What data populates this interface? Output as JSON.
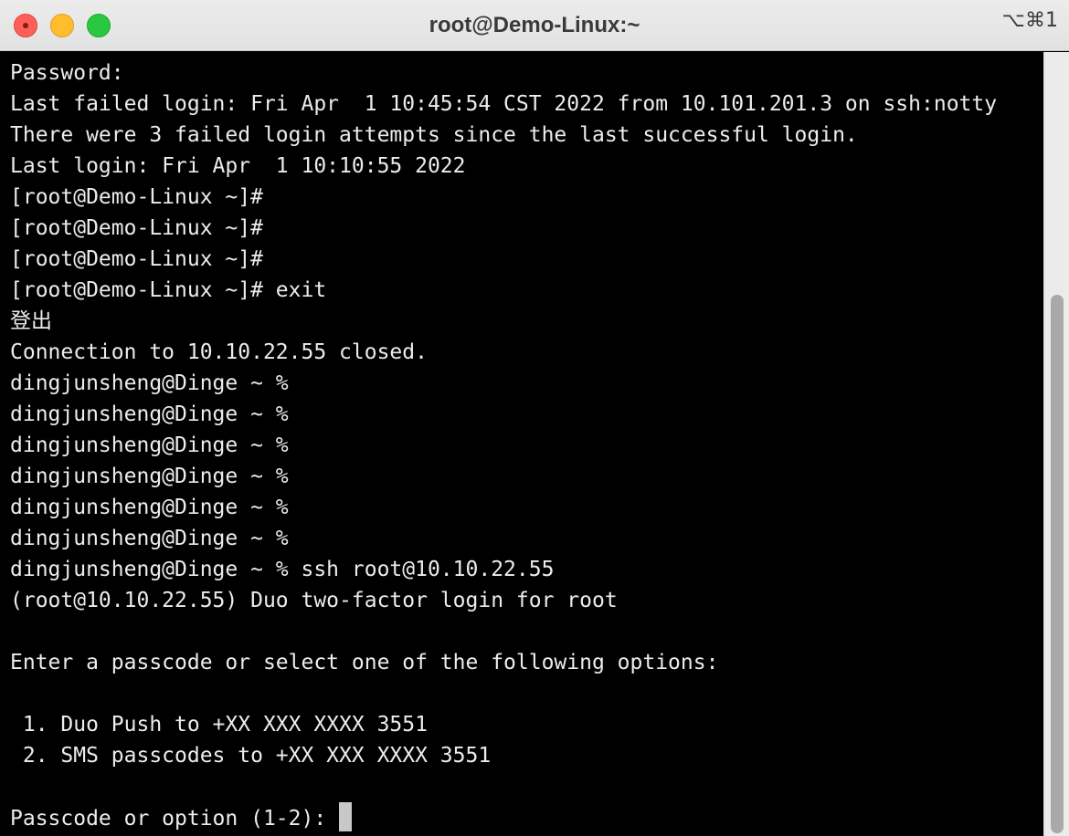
{
  "window": {
    "title": "root@Demo-Linux:~",
    "shortcut": "⌥⌘1"
  },
  "terminal": {
    "lines": [
      "Password:",
      "Last failed login: Fri Apr  1 10:45:54 CST 2022 from 10.101.201.3 on ssh:notty",
      "There were 3 failed login attempts since the last successful login.",
      "Last login: Fri Apr  1 10:10:55 2022",
      "[root@Demo-Linux ~]#",
      "[root@Demo-Linux ~]#",
      "[root@Demo-Linux ~]#",
      "[root@Demo-Linux ~]# exit",
      "登出",
      "Connection to 10.10.22.55 closed.",
      "dingjunsheng@Dinge ~ %",
      "dingjunsheng@Dinge ~ %",
      "dingjunsheng@Dinge ~ %",
      "dingjunsheng@Dinge ~ %",
      "dingjunsheng@Dinge ~ %",
      "dingjunsheng@Dinge ~ %",
      "dingjunsheng@Dinge ~ % ssh root@10.10.22.55",
      "(root@10.10.22.55) Duo two-factor login for root",
      "",
      "Enter a passcode or select one of the following options:",
      "",
      " 1. Duo Push to +XX XXX XXXX 3551",
      " 2. SMS passcodes to +XX XXX XXXX 3551",
      ""
    ],
    "prompt": "Passcode or option (1-2): "
  },
  "colors": {
    "background": "#000000",
    "foreground": "#ececec",
    "close": "#fe5f57",
    "minimize": "#febc2e",
    "zoom": "#28c840"
  }
}
